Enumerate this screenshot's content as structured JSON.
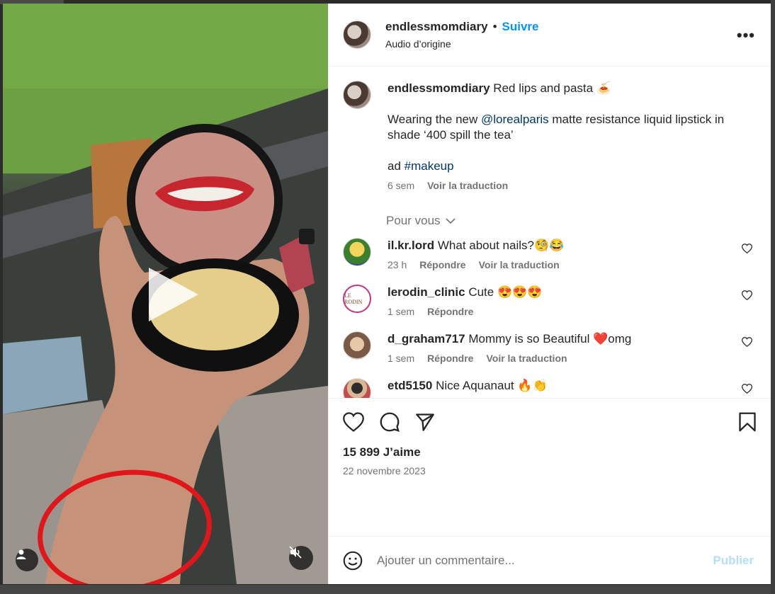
{
  "header": {
    "username": "endlessmomdiary",
    "separator": "•",
    "follow_label": "Suivre",
    "audio": "Audio d’origine",
    "more_label": "•••"
  },
  "caption": {
    "username": "endlessmomdiary",
    "line1": "Red lips and pasta 🍝",
    "line2_pre": "Wearing the new ",
    "mention": "@lorealparis",
    "line2_post": " matte resistance liquid lipstick in shade ‘400 spill the tea’",
    "line3_pre": "ad ",
    "hashtag": "#makeup",
    "time": "6 sem",
    "translate": "Voir la traduction"
  },
  "for_you": "Pour vous",
  "comments": [
    {
      "username": "il.kr.lord",
      "text": "What about nails?🧐😂",
      "time": "23 h",
      "reply": "Répondre",
      "translate": "Voir la traduction"
    },
    {
      "username": "lerodin_clinic",
      "text": "Cute 😍😍😍",
      "time": "1 sem",
      "reply": "Répondre",
      "avatar_text": "LE RODIN"
    },
    {
      "username": "d_graham717",
      "text": "Mommy is so Beautiful ❤️omg",
      "time": "1 sem",
      "reply": "Répondre",
      "translate": "Voir la traduction"
    },
    {
      "username": "etd5150",
      "text": "Nice Aquanaut 🔥👏"
    }
  ],
  "likes": "15 899 J’aime",
  "date": "22 novembre 2023",
  "add_comment": {
    "placeholder": "Ajouter un commentaire...",
    "publish": "Publier"
  },
  "icons": {
    "like": "heart-icon",
    "comment": "comment-bubble-icon",
    "share": "paper-plane-icon",
    "save": "bookmark-icon",
    "emoji": "smiley-icon",
    "play": "play-icon",
    "mute": "speaker-muted-icon",
    "user": "person-icon"
  },
  "colors": {
    "accent": "#0095f6",
    "muted": "#737373",
    "publish_disabled": "#b2dffc"
  }
}
